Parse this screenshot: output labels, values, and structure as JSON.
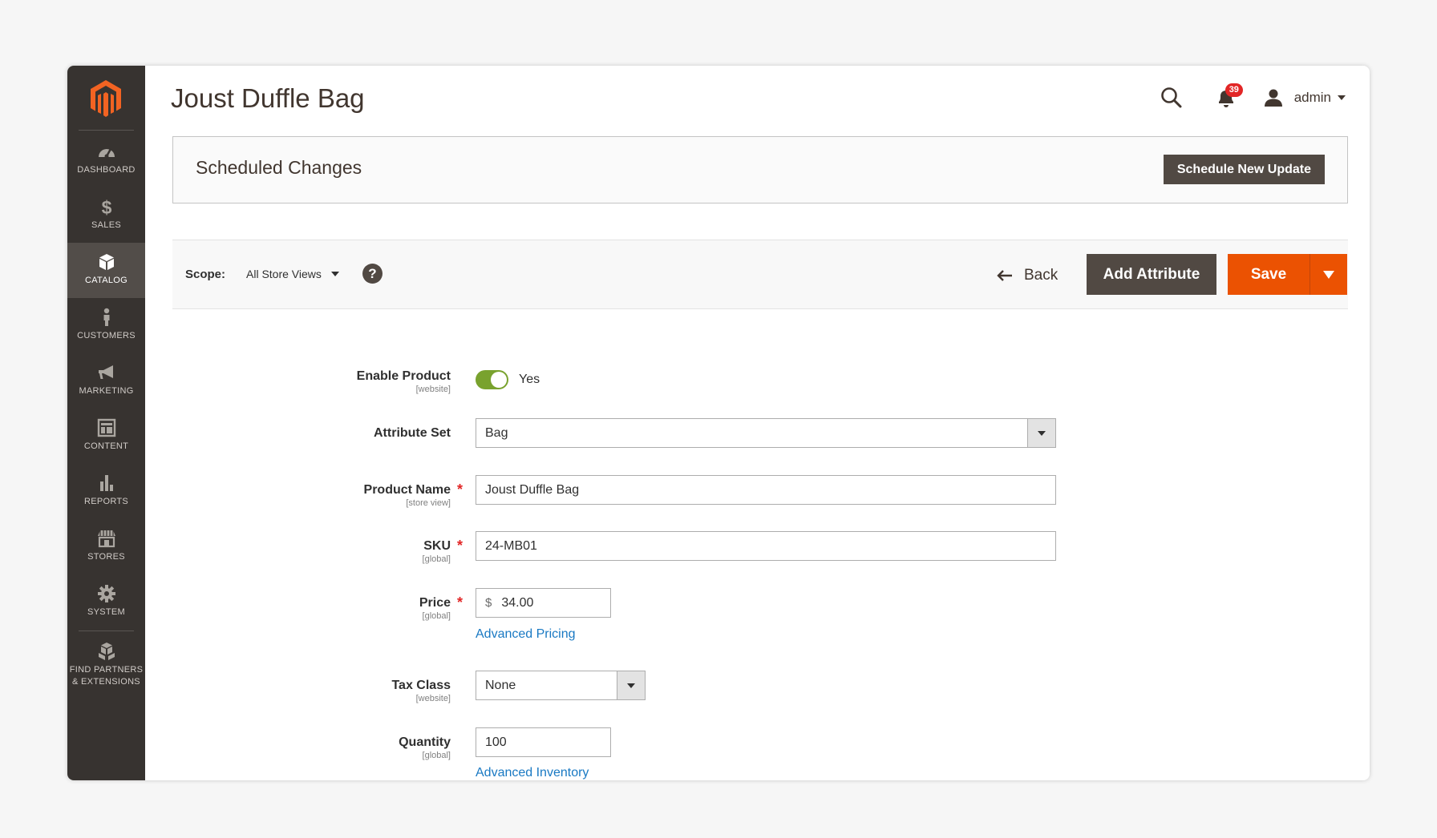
{
  "sidebar": {
    "items": [
      {
        "label": "DASHBOARD",
        "icon": "dashboard-icon"
      },
      {
        "label": "SALES",
        "icon": "dollar-icon"
      },
      {
        "label": "CATALOG",
        "icon": "box-icon",
        "active": true
      },
      {
        "label": "CUSTOMERS",
        "icon": "person-icon"
      },
      {
        "label": "MARKETING",
        "icon": "megaphone-icon"
      },
      {
        "label": "CONTENT",
        "icon": "layout-icon"
      },
      {
        "label": "REPORTS",
        "icon": "bar-chart-icon"
      },
      {
        "label": "STORES",
        "icon": "storefront-icon"
      },
      {
        "label": "SYSTEM",
        "icon": "gear-icon"
      },
      {
        "label_line1": "FIND PARTNERS",
        "label_line2": "& EXTENSIONS",
        "icon": "cubes-icon"
      }
    ]
  },
  "header": {
    "title": "Joust Duffle Bag",
    "notifications_count": "39",
    "user_name": "admin"
  },
  "scheduled": {
    "title": "Scheduled Changes",
    "button": "Schedule New Update"
  },
  "actions": {
    "scope_label": "Scope:",
    "scope_value": "All Store Views",
    "help": "?",
    "back": "Back",
    "add_attribute": "Add Attribute",
    "save": "Save"
  },
  "form": {
    "enable_product": {
      "label": "Enable Product",
      "scope": "[website]",
      "value": "Yes"
    },
    "attribute_set": {
      "label": "Attribute Set",
      "value": "Bag"
    },
    "product_name": {
      "label": "Product Name",
      "scope": "[store view]",
      "value": "Joust Duffle Bag"
    },
    "sku": {
      "label": "SKU",
      "scope": "[global]",
      "value": "24-MB01"
    },
    "price": {
      "label": "Price",
      "scope": "[global]",
      "currency": "$",
      "value": "34.00",
      "link": "Advanced Pricing"
    },
    "tax_class": {
      "label": "Tax Class",
      "scope": "[website]",
      "value": "None"
    },
    "quantity": {
      "label": "Quantity",
      "scope": "[global]",
      "value": "100",
      "link": "Advanced Inventory"
    },
    "required_mark": "*"
  },
  "colors": {
    "sidebar_bg": "#373330",
    "primary_orange": "#eb5202",
    "dark_button": "#514943",
    "link_blue": "#1979c3",
    "toggle_green": "#79a22e",
    "required_red": "#e22626"
  }
}
